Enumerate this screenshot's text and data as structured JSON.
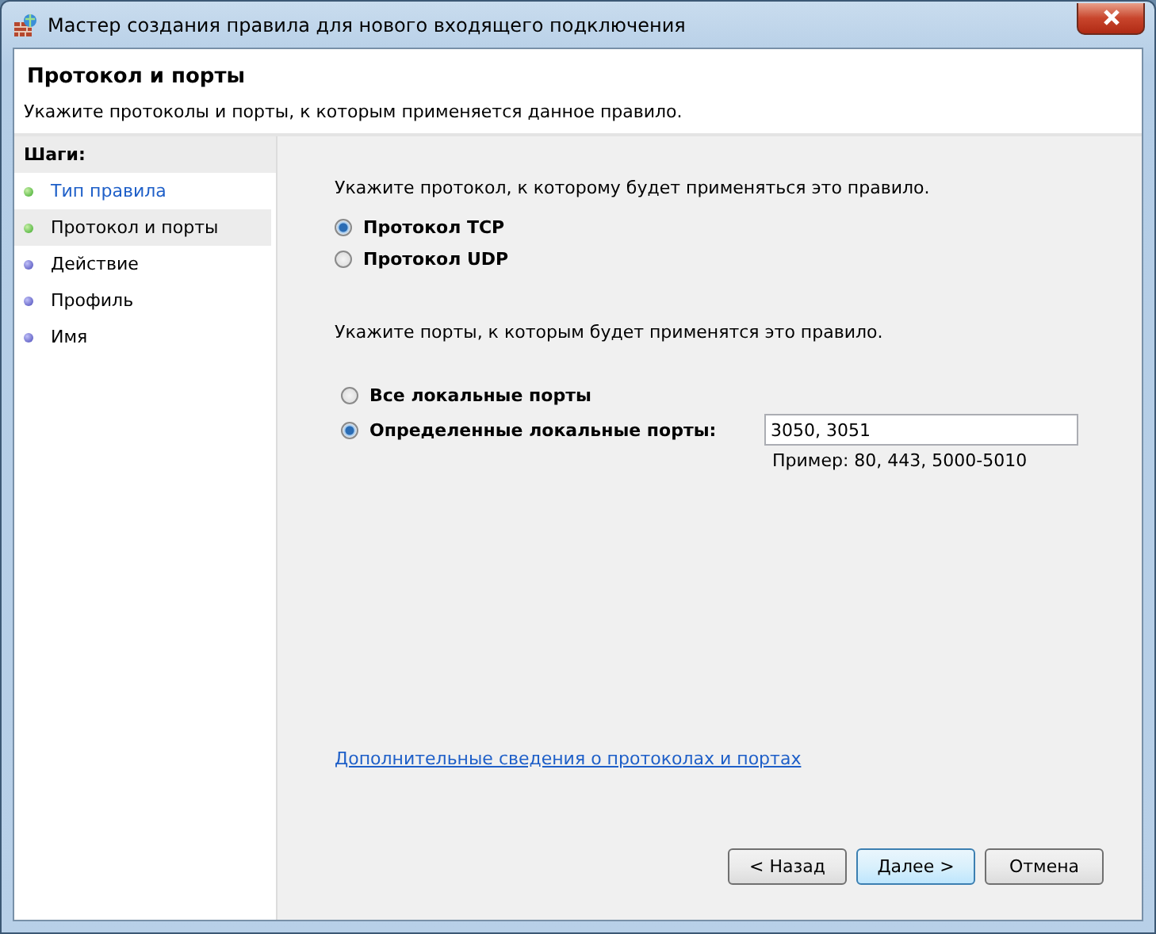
{
  "window": {
    "title": "Мастер создания правила для нового входящего подключения"
  },
  "header": {
    "title": "Протокол и порты",
    "subtitle": "Укажите протоколы и порты, к которым применяется данное правило."
  },
  "steps": {
    "heading": "Шаги:",
    "items": [
      {
        "label": "Тип правила",
        "completed": true,
        "selected": false
      },
      {
        "label": "Протокол и порты",
        "completed": true,
        "selected": true
      },
      {
        "label": "Действие",
        "completed": false,
        "selected": false
      },
      {
        "label": "Профиль",
        "completed": false,
        "selected": false
      },
      {
        "label": "Имя",
        "completed": false,
        "selected": false
      }
    ]
  },
  "protocol": {
    "prompt": "Укажите протокол, к которому будет применяться это правило.",
    "options": [
      {
        "label": "Протокол TCP",
        "selected": true
      },
      {
        "label": "Протокол UDP",
        "selected": false
      }
    ]
  },
  "ports": {
    "prompt": "Укажите порты, к которым будет применятся это правило.",
    "options": [
      {
        "label": "Все локальные порты",
        "selected": false
      },
      {
        "label": "Определенные локальные порты:",
        "selected": true
      }
    ],
    "value": "3050, 3051",
    "example": "Пример: 80, 443, 5000-5010"
  },
  "help_link": "Дополнительные сведения о протоколах и портах",
  "buttons": [
    {
      "label": "< Назад",
      "default": false
    },
    {
      "label": "Далее >",
      "default": true
    },
    {
      "label": "Отмена",
      "default": false
    }
  ]
}
